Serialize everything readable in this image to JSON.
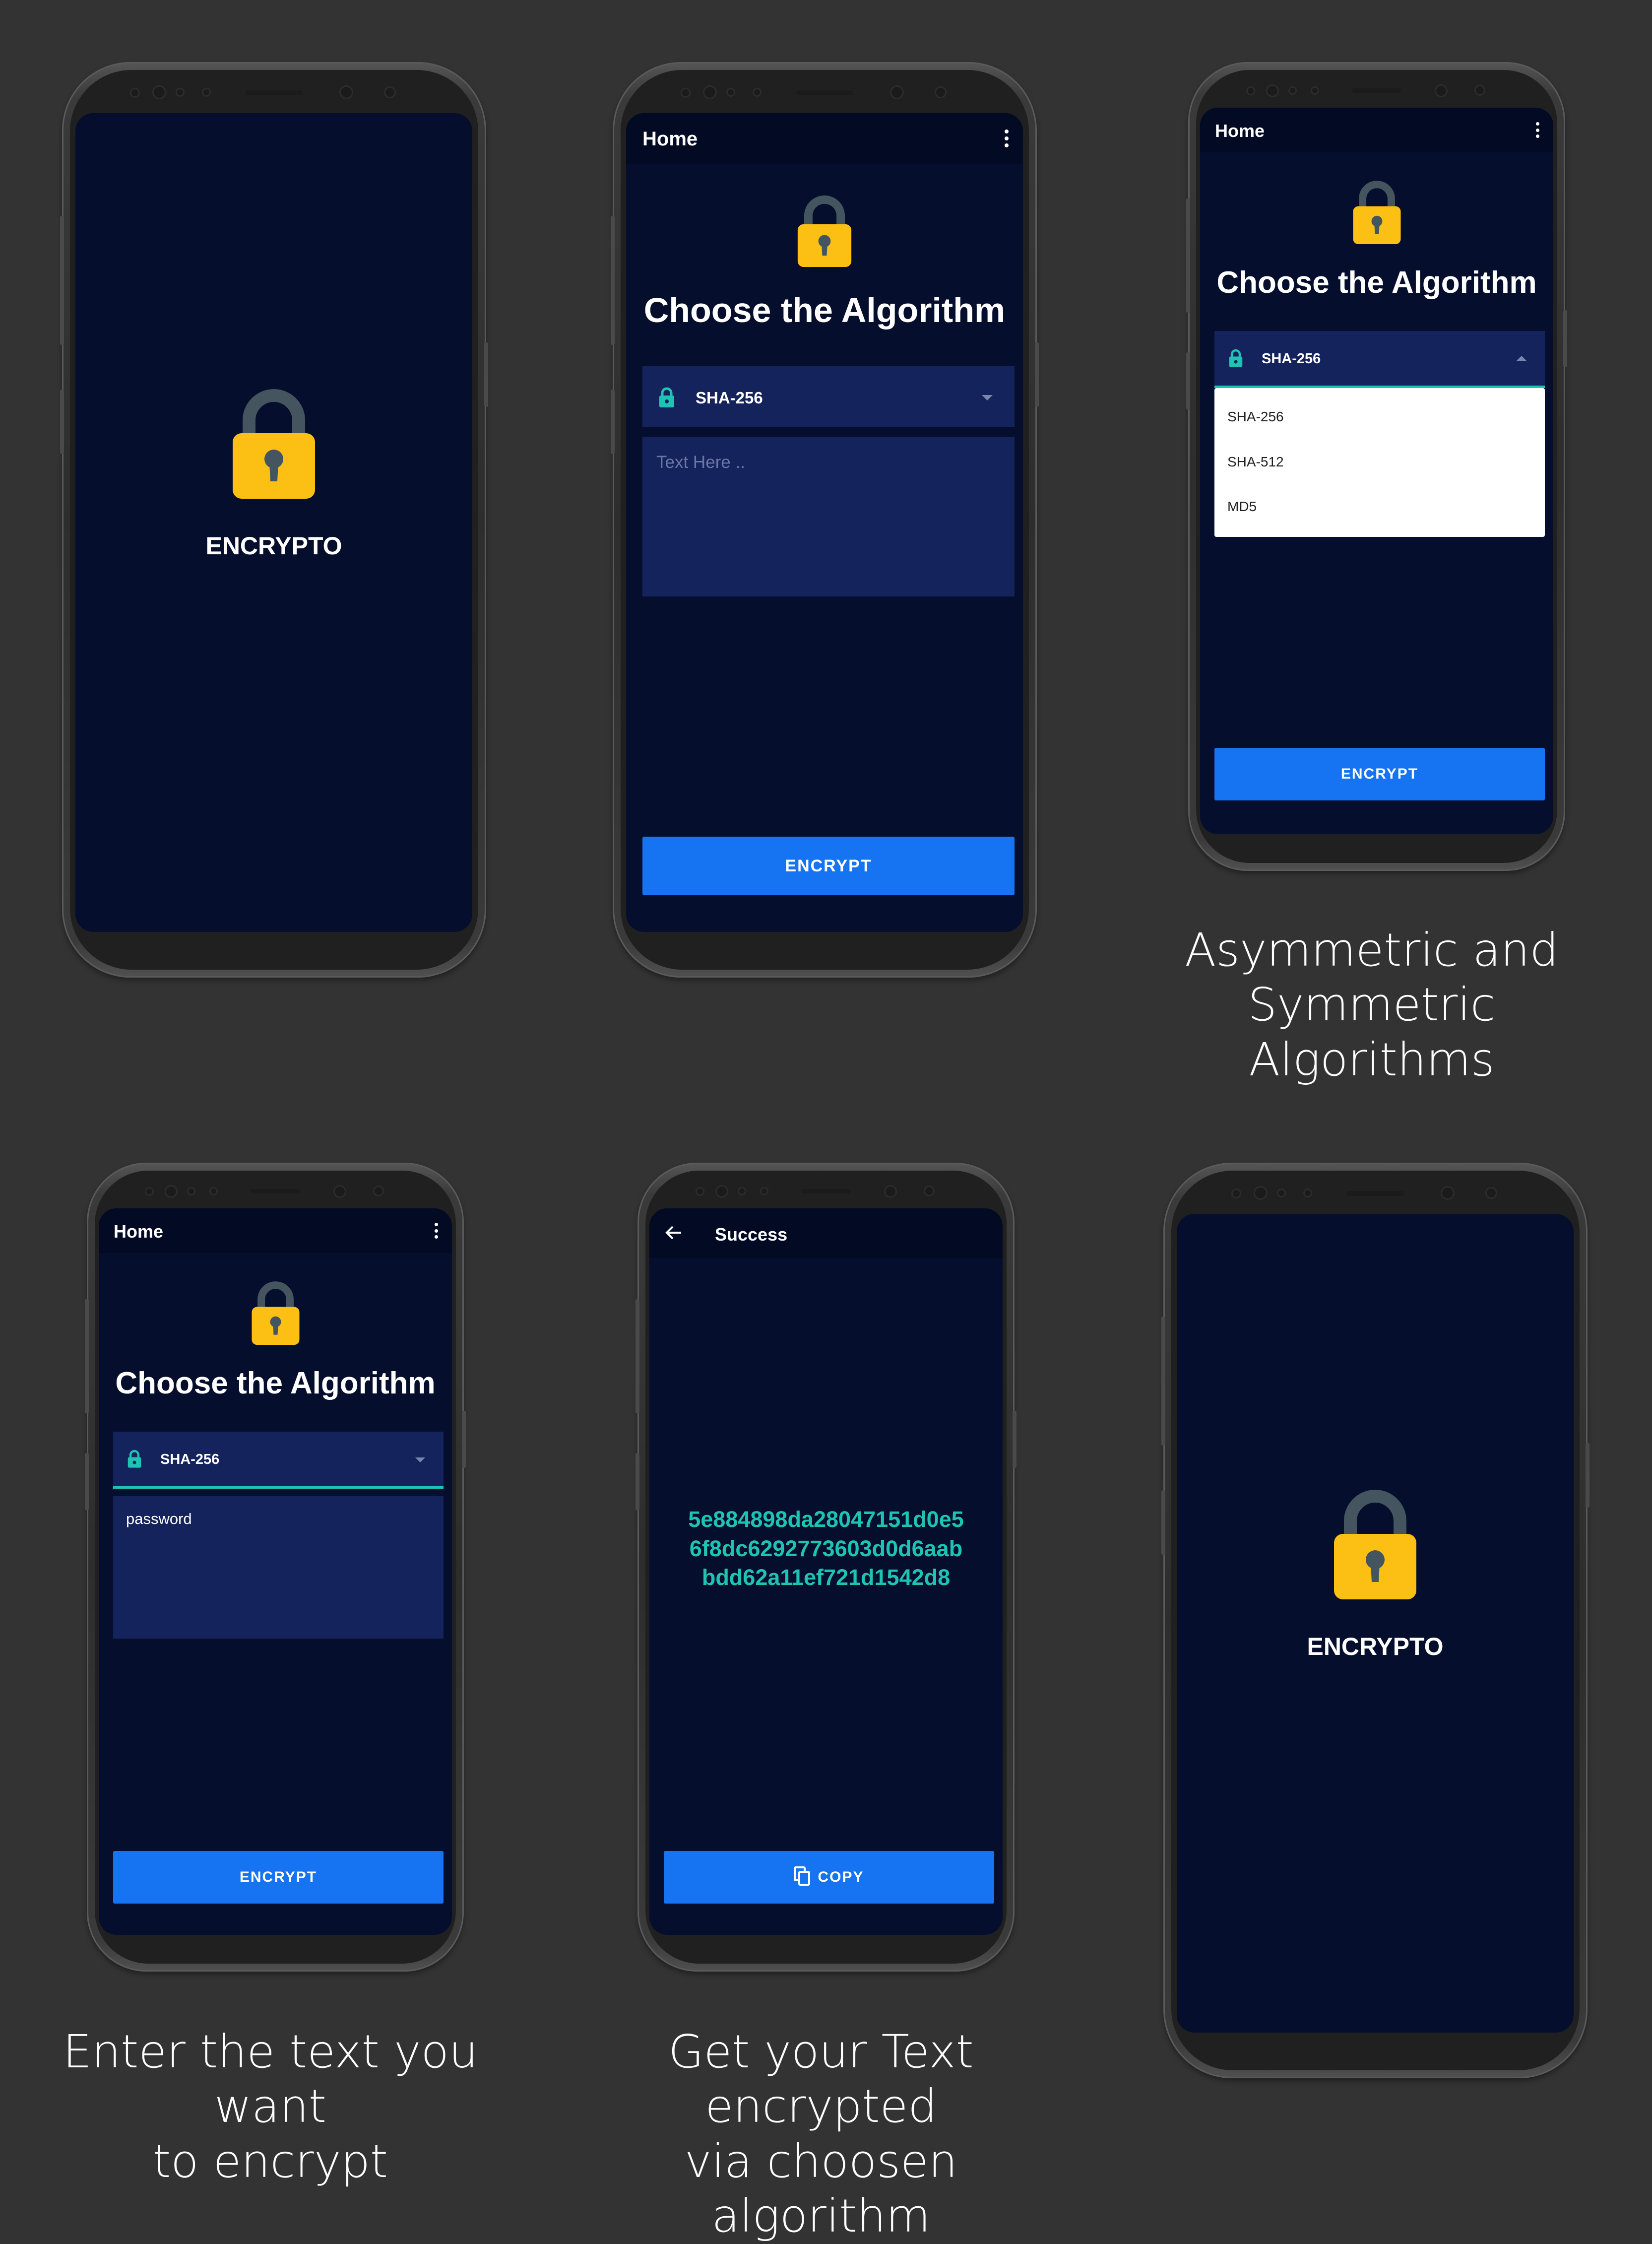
{
  "colors": {
    "background": "#333333",
    "screen": "#050e2c",
    "appbar": "#030a24",
    "field": "#15235d",
    "accent": "#1673f1",
    "teal": "#1ec4b3",
    "lock_body": "#fcc015",
    "lock_shackle": "#45555f"
  },
  "splash": {
    "brand": "ENCRYPTO",
    "icon": "padlock-icon"
  },
  "home": {
    "appbar_title": "Home",
    "menu_icon": "more-vert-icon",
    "heading": "Choose the Algorithm",
    "select_value": "SHA-256",
    "text_placeholder": "Text Here ..",
    "text_value": "password",
    "encrypt_label": "ENCRYPT"
  },
  "dropdown": {
    "options": [
      "SHA-256",
      "SHA-512",
      "MD5"
    ]
  },
  "result": {
    "appbar_title": "Success",
    "hash_lines": [
      "5e884898da28047151d0e5",
      "6f8dc6292773603d0d6aab",
      "bdd62a11ef721d1542d8"
    ],
    "copy_label": "COPY"
  },
  "captions": {
    "algorithms": [
      "Asymmetric and",
      "Symmetric Algorithms"
    ],
    "enter_text": [
      "Enter the text you want",
      "to encrypt"
    ],
    "encrypted": [
      "Get your Text encrypted",
      "via choosen algorithm"
    ]
  }
}
